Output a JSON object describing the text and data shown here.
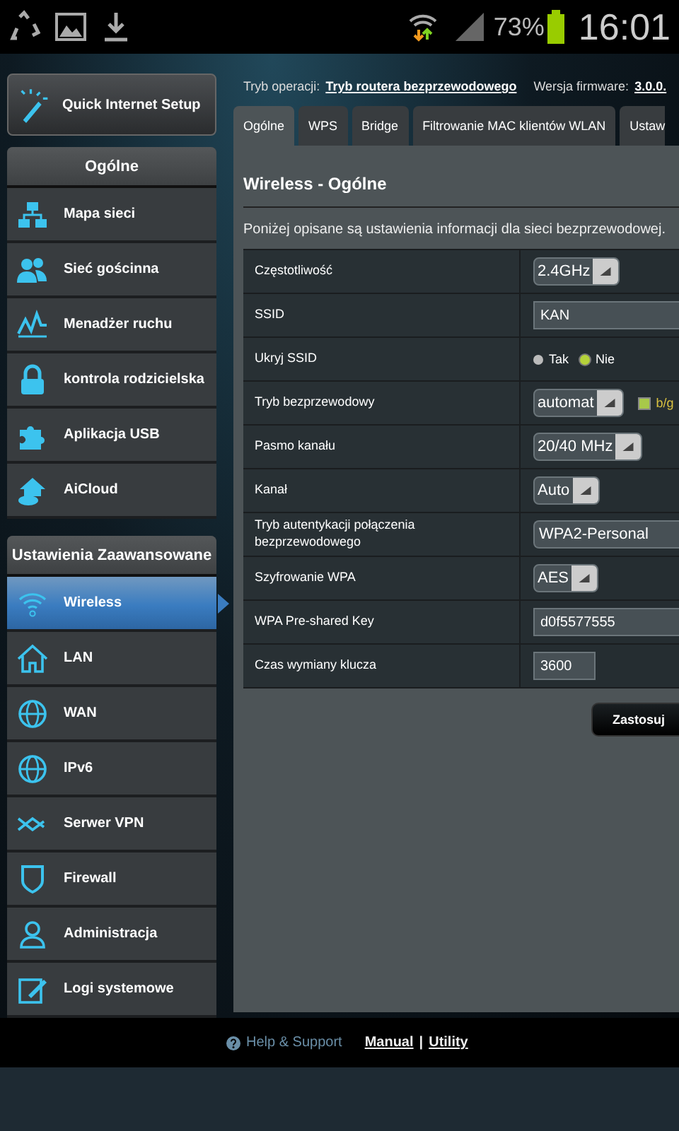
{
  "status_bar": {
    "battery": "73%",
    "time": "16:01"
  },
  "quick_setup": {
    "label": "Quick Internet Setup"
  },
  "sidebar_general": {
    "title": "Ogólne",
    "items": [
      {
        "label": "Mapa sieci",
        "selected": false
      },
      {
        "label": "Sieć gościnna",
        "selected": false
      },
      {
        "label": "Menadżer ruchu",
        "selected": false
      },
      {
        "label": "kontrola rodzicielska",
        "selected": false
      },
      {
        "label": "Aplikacja USB",
        "selected": false
      },
      {
        "label": "AiCloud",
        "selected": false
      }
    ]
  },
  "sidebar_advanced": {
    "title": "Ustawienia Zaawansowane",
    "items": [
      {
        "label": "Wireless",
        "selected": true
      },
      {
        "label": "LAN",
        "selected": false
      },
      {
        "label": "WAN",
        "selected": false
      },
      {
        "label": "IPv6",
        "selected": false
      },
      {
        "label": "Serwer VPN",
        "selected": false
      },
      {
        "label": "Firewall",
        "selected": false
      },
      {
        "label": "Administracja",
        "selected": false
      },
      {
        "label": "Logi systemowe",
        "selected": false
      }
    ]
  },
  "info_bar": {
    "mode_label": "Tryb operacji:",
    "mode_value": "Tryb routera bezprzewodowego",
    "firmware_label": "Wersja firmware:",
    "firmware_value": "3.0.0."
  },
  "tabs": [
    {
      "label": "Ogólne",
      "selected": true
    },
    {
      "label": "WPS",
      "selected": false
    },
    {
      "label": "Bridge",
      "selected": false
    },
    {
      "label": "Filtrowanie MAC klientów WLAN",
      "selected": false
    },
    {
      "label": "Ustaw",
      "selected": false
    }
  ],
  "page_title": "Wireless - Ogólne",
  "description": "Poniżej opisane są ustawienia informacji dla sieci bezprzewodowej.",
  "settings": [
    {
      "label": "Częstotliwość",
      "kind": "select",
      "value": "2.4GHz"
    },
    {
      "label": "SSID",
      "kind": "text",
      "value": "KAN"
    },
    {
      "label": "Ukryj SSID",
      "kind": "radio",
      "options": [
        {
          "label": "Tak",
          "selected": false
        },
        {
          "label": "Nie",
          "selected": true
        }
      ]
    },
    {
      "label": "Tryb bezprzewodowy",
      "kind": "select",
      "value": "automat",
      "check": {
        "label": "b/g",
        "checked": true
      }
    },
    {
      "label": "Pasmo kanału",
      "kind": "select",
      "value": "20/40 MHz"
    },
    {
      "label": "Kanał",
      "kind": "select",
      "value": "Auto"
    },
    {
      "label": "Tryb autentykacji połączenia bezprzewodowego",
      "kind": "select_wide",
      "value": "WPA2-Personal"
    },
    {
      "label": "Szyfrowanie WPA",
      "kind": "select",
      "value": "AES"
    },
    {
      "label": "WPA Pre-shared Key",
      "kind": "text",
      "value": "d0f5577555"
    },
    {
      "label": "Czas wymiany klucza",
      "kind": "short_text",
      "value": "3600"
    }
  ],
  "apply_button": "Zastosuj",
  "footer": {
    "help": "Help & Support",
    "manual": "Manual",
    "separator": "|",
    "utility": "Utility"
  }
}
